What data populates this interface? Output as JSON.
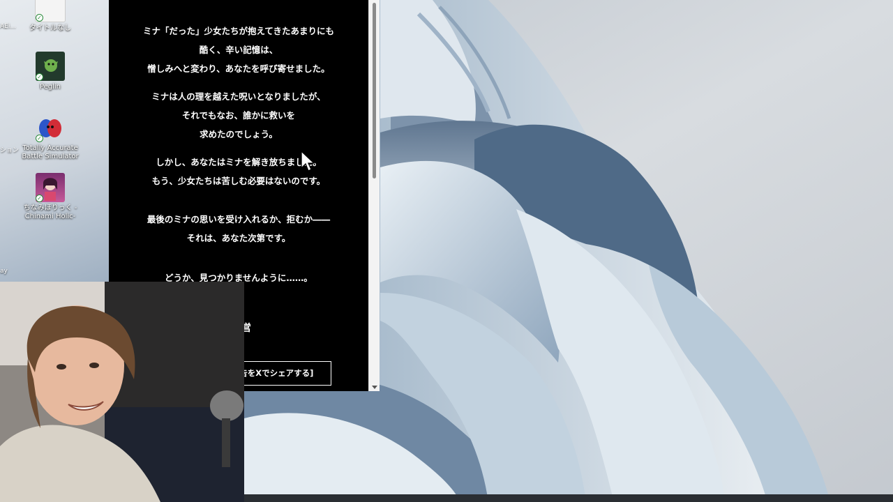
{
  "desktop": {
    "icons": [
      {
        "label": "タイトルなし"
      },
      {
        "label": "Peglin"
      },
      {
        "label": "Totally Accurate Battle Simulator"
      },
      {
        "label": "ちなみほりっく -Chinami Holic-"
      }
    ],
    "edge_labels": [
      "AEi...",
      "ション",
      "ay"
    ]
  },
  "page": {
    "paragraphs": [
      [
        "ミナ「だった」少女たちが抱えてきたあまりにも",
        "酷く、辛い記憶は、",
        "憎しみへと変わり、あなたを呼び寄せました。"
      ],
      [
        "ミナは人の理を越えた呪いとなりましたが、",
        "それでもなお、誰かに救いを",
        "求めたのでしょう。"
      ],
      [
        "しかし、あなたはミナを解き放ちました。",
        "もう、少女たちは苦しむ必要はないのです。"
      ],
      [
        "最後のミナの思いを受け入れるか、拒むか――",
        "それは、あなた次第です。"
      ],
      [
        "どうか、見つかりませんように……。"
      ]
    ],
    "operator": "運 営",
    "share_button": "[この体験やクリア報告をXでシェアする]"
  },
  "colors": {
    "page_bg": "#000000",
    "page_text": "#ffffff",
    "scrollbar": "#f3f3f3"
  }
}
